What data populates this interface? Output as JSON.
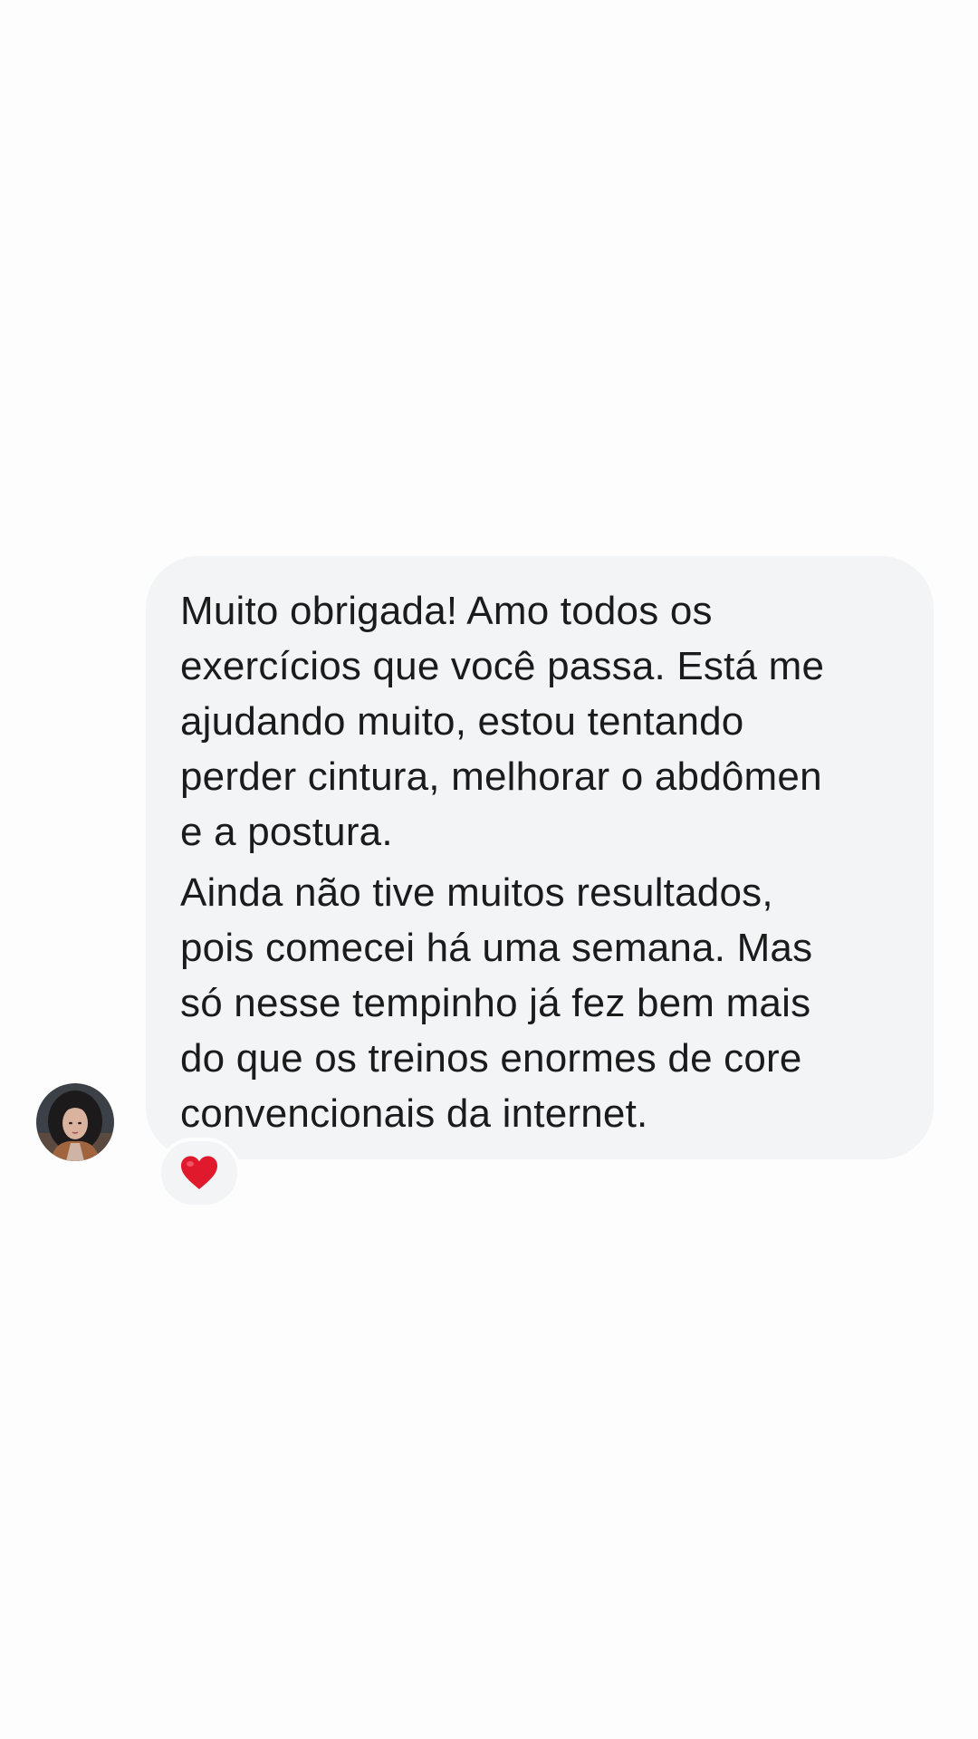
{
  "chat": {
    "message": {
      "paragraph_1": "Muito obrigada! Amo todos os\nexercícios que você passa. Está me\najudando muito, estou tentando\nperder cintura, melhorar o abdômen\ne a postura.",
      "paragraph_2": "Ainda não tive muitos resultados,\npois comecei há uma semana. Mas\nsó nesse tempinho já fez bem mais\ndo que os treinos enormes de core\nconvencionais da internet."
    },
    "sender_avatar_icon": "user-avatar",
    "reaction": {
      "icon": "heart-icon",
      "color": "#e0192d"
    },
    "bubble_color": "#f3f4f6",
    "background_color": "#fdfdfd"
  }
}
